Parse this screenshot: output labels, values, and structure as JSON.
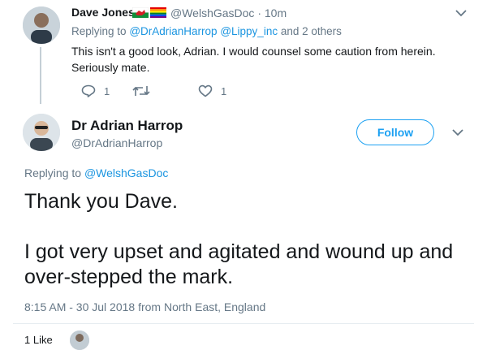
{
  "reply_context": {
    "user": {
      "display_name": "Dave Jones",
      "flags": [
        "wales-flag-icon",
        "rainbow-flag-icon"
      ],
      "handle": "@WelshGasDoc",
      "time_sep": "·",
      "time": "10m"
    },
    "replying_to": {
      "prefix": "Replying to",
      "mention_1": "@DrAdrianHarrop",
      "mention_2": "@Lippy_inc",
      "suffix": "and 2 others"
    },
    "text": "This isn't a good look, Adrian. I would counsel some caution from herein. Seriously mate.",
    "actions": {
      "reply_count": "1",
      "retweet_count": "",
      "like_count": "1"
    }
  },
  "main_tweet": {
    "display_name": "Dr Adrian Harrop",
    "handle": "@DrAdrianHarrop",
    "follow_label": "Follow",
    "replying_to_prefix": "Replying to",
    "replying_to_handle": "@WelshGasDoc",
    "paragraphs": [
      "Thank you Dave.",
      "I got very upset and agitated and wound up and over-stepped the mark."
    ],
    "timestamp": "8:15 AM - 30 Jul 2018 from North East, England",
    "likes_label": "1 Like"
  },
  "colors": {
    "link": "#1b95e0",
    "muted": "#657786",
    "follow_blue": "#1da1f2",
    "text": "#14171a"
  }
}
